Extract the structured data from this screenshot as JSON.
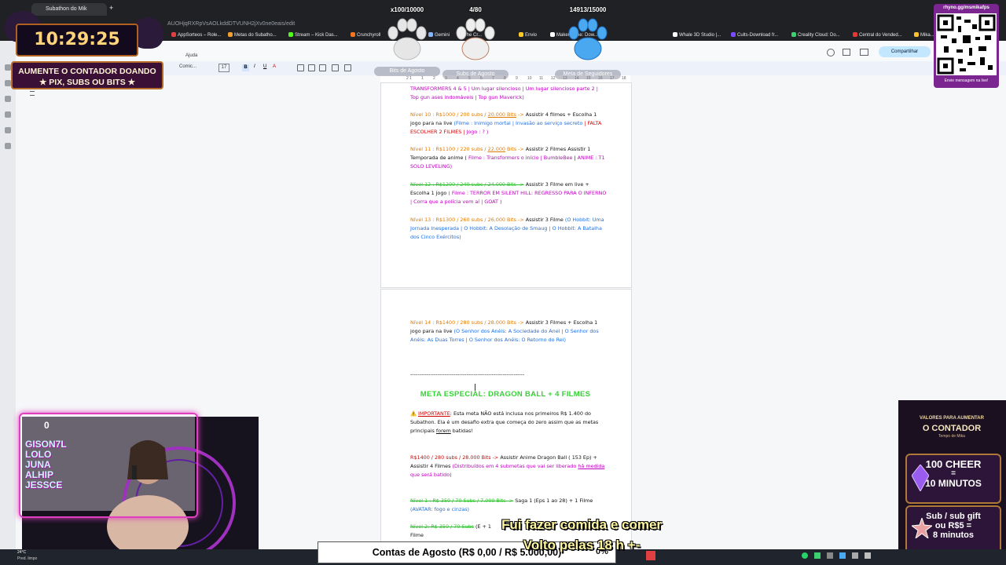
{
  "browser": {
    "active_tab": "Subathon do Mik",
    "url": "AUOHjqRXRpVsAOLkddDTVUNH2jXv0ne0eais/edit",
    "bookmarks": [
      "AppSorteos – Role...",
      "Metas do Subatho...",
      "Stream – Kick Das...",
      "Crunchyroll",
      "Gemini",
      "The Cr...",
      "Envio",
      "Makeronline: Dow...",
      "Whale 3D Studio |...",
      "Cults-Download fr...",
      "Creality Cloud: Do...",
      "Central do Vended...",
      "Mika..."
    ]
  },
  "docs": {
    "menu": [
      "Ajuda"
    ],
    "font": "Comic...",
    "font_size": "17",
    "share_label": "Compartilhar",
    "ruler_ticks": [
      "2",
      "1",
      "1",
      "2",
      "3",
      "4",
      "5",
      "6",
      "7",
      "8",
      "9",
      "10",
      "11",
      "12",
      "13",
      "14",
      "15",
      "16",
      "17",
      "18"
    ]
  },
  "overlays": {
    "clock": "10:29:25",
    "timer_banner": [
      "AUMENTE O CONTADOR DOANDO",
      "★ PIX, SUBS OU BITS ★"
    ],
    "goals": [
      {
        "label": "Bits de Agosto",
        "count": "x100/10000"
      },
      {
        "label": "Subs de Agosto",
        "count": "4/80"
      },
      {
        "label": "Meta de Seguidores",
        "count": "14913/15000"
      }
    ],
    "qr_header": "rhyno.gg/msmikafps",
    "qr_footer": "Envie mensagem na live!",
    "cam_counter": "0",
    "cam_overlay_text": [
      "GISON7L",
      "LOLO",
      "JUNA",
      "ALHIP",
      "JESSCE"
    ],
    "cheer": {
      "title": "VALORES PARA AUMENTAR",
      "subtitle": "O CONTADOR",
      "tagline": "Tempo de Mika",
      "cards": [
        {
          "line1": "100 CHEER",
          "line2": "=",
          "line3": "10 MINUTOS"
        },
        {
          "line1": "Sub / sub gift",
          "line2": "ou R$5 =",
          "line3": "8 minutos"
        }
      ]
    },
    "subtitle": [
      "Fui fazer comida e comer",
      "Volto pelas 18 h +-"
    ],
    "contas": "Contas de Agosto (R$ 0,00 / R$ 5.000,00)",
    "percent": "0%",
    "weather": {
      "temp": "24°C",
      "desc": "Pred. limpo"
    }
  },
  "document": {
    "p0": [
      {
        "t": "TRANSFORMERS 4 & 5 | Um lugar silencioso | Um lugar silencioso parte 2 | Top gun ases indomáveis | Top gun Maverick)",
        "c": "p"
      }
    ],
    "p1": [
      {
        "t": "Nível 10 : R$1000 / 200 subs / ",
        "c": "o"
      },
      {
        "t": "20.000 Bits",
        "c": "o",
        "u": true
      },
      {
        "t": " -> ",
        "c": "o"
      },
      {
        "t": "Assistir 4 filmes + Escolha 1 jogo para na live ",
        "c": "k"
      },
      {
        "t": "(Filme : Inimigo mortal | Invasão ao serviço secreto",
        "c": "b"
      },
      {
        "t": " | FALTA ESCOLHER 2 FILMES | ",
        "c": "r"
      },
      {
        "t": "Jogo : ? )",
        "c": "p"
      }
    ],
    "p2": [
      {
        "t": "Nível 11 : R$1100 / 220 subs / ",
        "c": "o"
      },
      {
        "t": "22.000",
        "c": "o",
        "u": true
      },
      {
        "t": " Bits -> ",
        "c": "o"
      },
      {
        "t": "Assistir 2 Filmes Assistir 1 Temporada de anime ( ",
        "c": "k"
      },
      {
        "t": "Filme : Transformers o início | BumbleBee",
        "c": "p"
      },
      {
        "t": " | ",
        "c": "k"
      },
      {
        "t": "ANIME : T1 SOLO LEVELING)",
        "c": "p"
      }
    ],
    "p3": [
      {
        "t": "Nível 12 : R$1200 / 240 subs / 24.000 Bits ->",
        "c": "g",
        "s": true
      },
      {
        "t": " Assistir 3 Filme em live + Escolha 1 jogo ",
        "c": "k"
      },
      {
        "t": "( Filme : TERROR EM SILENT HILL: REGRESSO PARA O INFERNO | Corra que a polícia vem aí | GOAT )",
        "c": "p"
      }
    ],
    "p4": [
      {
        "t": "Nível 13 : R$1300 / 260 subs / 26.000 Bits -> ",
        "c": "o"
      },
      {
        "t": "Assistir 3 Filme ",
        "c": "k"
      },
      {
        "t": "(O Hobbit: Uma Jornada Inesperada | O Hobbit: A Desolação de Smaug | O Hobbit: A Batalha dos Cinco Exércitos)",
        "c": "b"
      }
    ],
    "p5": [
      {
        "t": "Nível 14 : R$1400 / 280 subs / 28.000 Bits -> ",
        "c": "o"
      },
      {
        "t": " Assistir 3 Filmes + Escolha 1 jogo para na live ",
        "c": "k"
      },
      {
        "t": "(O Senhor dos Anéis: A Sociedade do Anel | O Senhor dos Anéis: As Duas Torres | O Senhor dos Anéis: O Retorno do Rei)",
        "c": "b"
      }
    ],
    "divider": "---------------------------------------------------------------",
    "meta_title": "META ESPECIAL: DRAGON BALL + 4 FILMES",
    "p6": [
      {
        "t": "⚠️ ",
        "c": "o"
      },
      {
        "t": "IMPORTANTE",
        "c": "r",
        "u": true
      },
      {
        "t": ": Esta meta NÃO está inclusa nos primeiros R$ 1.400 do Subathon. Ela é um desafio extra que começa do zero assim que as metas principais ",
        "c": "k"
      },
      {
        "t": "forem",
        "c": "k",
        "u": true
      },
      {
        "t": " batidas!",
        "c": "k"
      }
    ],
    "p7": [
      {
        "t": "R$1400 / 280 subs / 28.000 Bits -> ",
        "c": "r"
      },
      {
        "t": "Assistir Anime Dragon Ball ( 153 Ep) + Assistir 4 Filmes ",
        "c": "k"
      },
      {
        "t": "(Distribuídos em 4 submetas que vai ser liberado ",
        "c": "p"
      },
      {
        "t": "há medida",
        "c": "p",
        "u": true
      },
      {
        "t": " que será batido)",
        "c": "p"
      }
    ],
    "p8": [
      {
        "t": "Nível 1 : R$ 350 / 70 Subs / 7.000 Bits ->",
        "c": "g",
        "s": true
      },
      {
        "t": " Saga 1 (Eps 1 ao 28) + 1 Filme ",
        "c": "k"
      },
      {
        "t": "(AVATAR: fogo e cinzas)",
        "c": "b"
      }
    ],
    "p9": [
      {
        "t": "Nível 2: R$ 350 / 70 Subs",
        "c": "g",
        "s": true
      },
      {
        "t": " (E",
        "c": "k"
      },
      {
        "t": " + 1 Filme",
        "c": "k"
      }
    ]
  }
}
